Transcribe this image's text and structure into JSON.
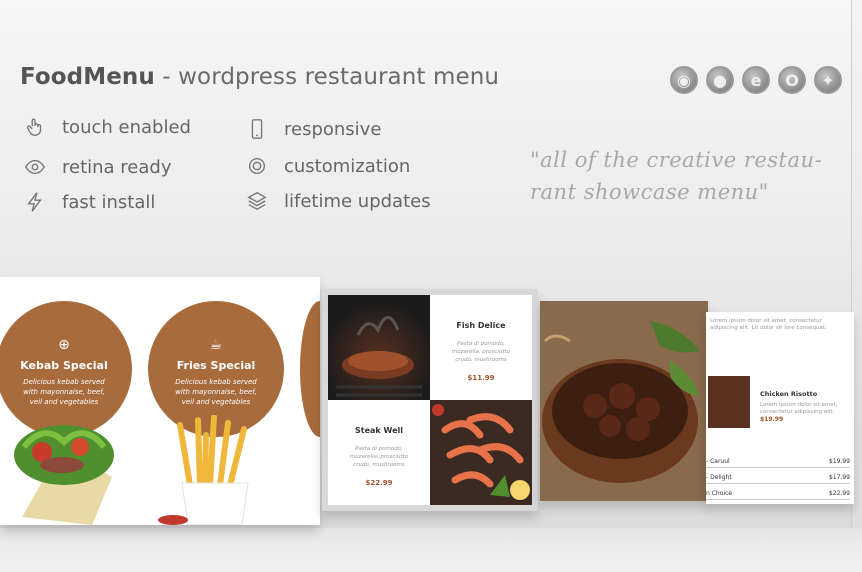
{
  "header": {
    "brand": "FoodMenu",
    "tagline": " - wordpress restaurant menu"
  },
  "features": [
    {
      "icon": "touch-icon",
      "label": "touch enabled"
    },
    {
      "icon": "retina-eye-icon",
      "label": "retina ready"
    },
    {
      "icon": "lightning-icon",
      "label": "fast install"
    },
    {
      "icon": "mobile-phone-icon",
      "label": "responsive"
    },
    {
      "icon": "gear-icon",
      "label": "customization"
    },
    {
      "icon": "layers-icon",
      "label": "lifetime updates"
    }
  ],
  "browsers": [
    {
      "icon": "chrome-icon",
      "glyph": "◉"
    },
    {
      "icon": "firefox-icon",
      "glyph": "●"
    },
    {
      "icon": "internet-explorer-icon",
      "glyph": "e"
    },
    {
      "icon": "opera-icon",
      "glyph": "O"
    },
    {
      "icon": "safari-icon",
      "glyph": "✦"
    }
  ],
  "quote": "\"all of the creative restau-rant showcase menu\"",
  "showcase": {
    "circles": [
      {
        "name": "Kebab Special",
        "desc": "Delicious kebab served with mayonnaise, beef, veil and vegetables"
      },
      {
        "name": "Fries Special",
        "desc": "Delicious kebab served with mayonnaise, beef, veil and vegetables"
      }
    ],
    "grid_items": [
      {
        "name": "Fish Delice",
        "desc": "Pasta di pomodo, mozarella, prosciutto crudo, mushrooms",
        "price": "$11.99"
      },
      {
        "name": "Steak Well",
        "desc": "Pasta di pomodo, mozarella, prosciutto crudo, mushrooms",
        "price": "$22.99"
      }
    ],
    "list_panel": {
      "intro": "Lorem ipsum dolor sit amet, consectetur adipiscing elit. Lit dolor sit lore consequat.",
      "featured_name": "Chicken Risotto",
      "featured_desc": "Lorem ipsum dolor sit amet, consectetur adipiscing elit.",
      "featured_price": "$19.99",
      "rows": [
        {
          "name": "- Caruul",
          "price": "$19.99"
        },
        {
          "name": "- Delight",
          "price": "$17.99"
        },
        {
          "name": "n Choice",
          "price": "$22.99"
        }
      ]
    }
  },
  "colors": {
    "accent": "#a86b3c",
    "price": "#a0522d",
    "text": "#666666"
  }
}
